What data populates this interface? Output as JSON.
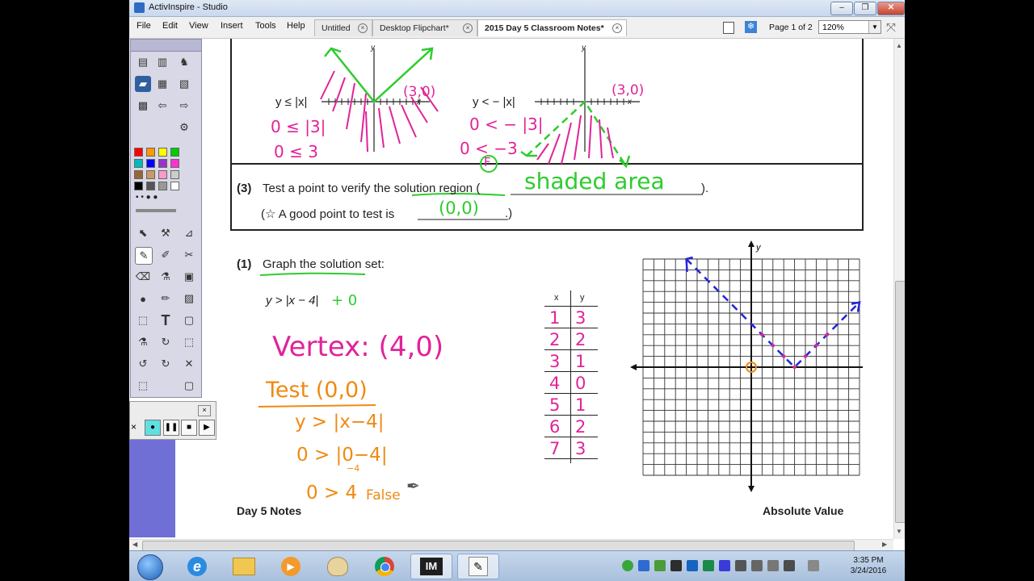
{
  "window": {
    "title": "ActivInspire - Studio"
  },
  "menus": [
    "File",
    "Edit",
    "View",
    "Insert",
    "Tools",
    "Help"
  ],
  "tabs": [
    {
      "label": "Untitled"
    },
    {
      "label": "Desktop Flipchart*"
    },
    {
      "label": "2015 Day 5 Classroom Notes*",
      "active": true
    }
  ],
  "page_indicator": "Page 1 of 2",
  "zoom": "120%",
  "flipchart": {
    "top_left_ineq": "y ≤ |x|",
    "top_right_ineq": "y < − |x|",
    "step3_num": "(3)",
    "step3_text": "Test a point to verify the solution region (",
    "step3_close": ").",
    "step3_hint_prefix": "(☆ A good point to test is",
    "step3_hint_suffix": ".)",
    "problem_num": "(1)",
    "problem_text": "Graph the solution set:",
    "equation": "y > |x − 4|",
    "footer_left": "Day 5 Notes",
    "footer_right": "Absolute Value",
    "axis_x": "x",
    "axis_y": "y",
    "handwriting": {
      "top_left_line1": "0 ≤ |3|",
      "top_left_line2": "0 ≤ 3",
      "top_left_point": "(3,0)",
      "top_right_point": "(3,0)",
      "top_right_line1": "0 < − |3|",
      "top_right_line2": "0 < −3",
      "top_right_false": "F",
      "shaded_area": "shaded area",
      "point_to_test": "(0,0)",
      "plus_zero": "+ 0",
      "vertex": "Vertex: (4,0)",
      "test_title": "Test (0,0)",
      "test_line1": "y > |x−4|",
      "test_line2": "0 > |0−4|",
      "test_line2_sub": "−4",
      "test_line3": "0 > 4",
      "test_result": "False"
    },
    "table": {
      "headers": [
        "x",
        "y"
      ],
      "rows": [
        [
          "1",
          "3"
        ],
        [
          "2",
          "2"
        ],
        [
          "3",
          "1"
        ],
        [
          "4",
          "0"
        ],
        [
          "5",
          "1"
        ],
        [
          "6",
          "2"
        ],
        [
          "7",
          "3"
        ]
      ]
    }
  },
  "taskbar": {
    "items": [
      "internet-explorer",
      "file-explorer",
      "media-player",
      "paint",
      "chrome",
      "activinspire",
      "annotation"
    ],
    "time": "3:35 PM",
    "date": "3/24/2016"
  },
  "colors": {
    "pink": "#e0239a",
    "green": "#2ecc2e",
    "orange": "#ef8a12",
    "blue": "#2424d8"
  }
}
